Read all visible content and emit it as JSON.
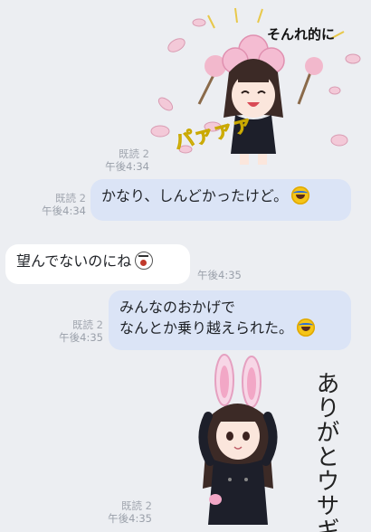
{
  "messages": [
    {
      "type": "sticker",
      "side": "out",
      "caption": "そんれ的に",
      "shout": "パァァァ",
      "read": "既読 2",
      "time": "午後4:34"
    },
    {
      "type": "text",
      "side": "out",
      "text": "かなり、しんどかったけど。",
      "emoji": "laugh-emoji",
      "read": "既読 2",
      "time": "午後4:34"
    },
    {
      "type": "text",
      "side": "in",
      "text": "望んでないのにね",
      "emoji": "shout-emoji",
      "time": "午後4:35"
    },
    {
      "type": "text",
      "side": "out",
      "line1": "みんなのおかげで",
      "line2": "なんとか乗り越えられた。",
      "emoji": "laugh-emoji",
      "read": "既読 2",
      "time": "午後4:35"
    },
    {
      "type": "sticker",
      "side": "out",
      "caption": "ありがとウサギ",
      "read": "既読 2",
      "time": "午後4:35"
    }
  ],
  "colors": {
    "background": "#eceef2",
    "outgoing_bubble": "#dbe4f6",
    "incoming_bubble": "#ffffff",
    "meta_text": "#a2a7b0"
  }
}
